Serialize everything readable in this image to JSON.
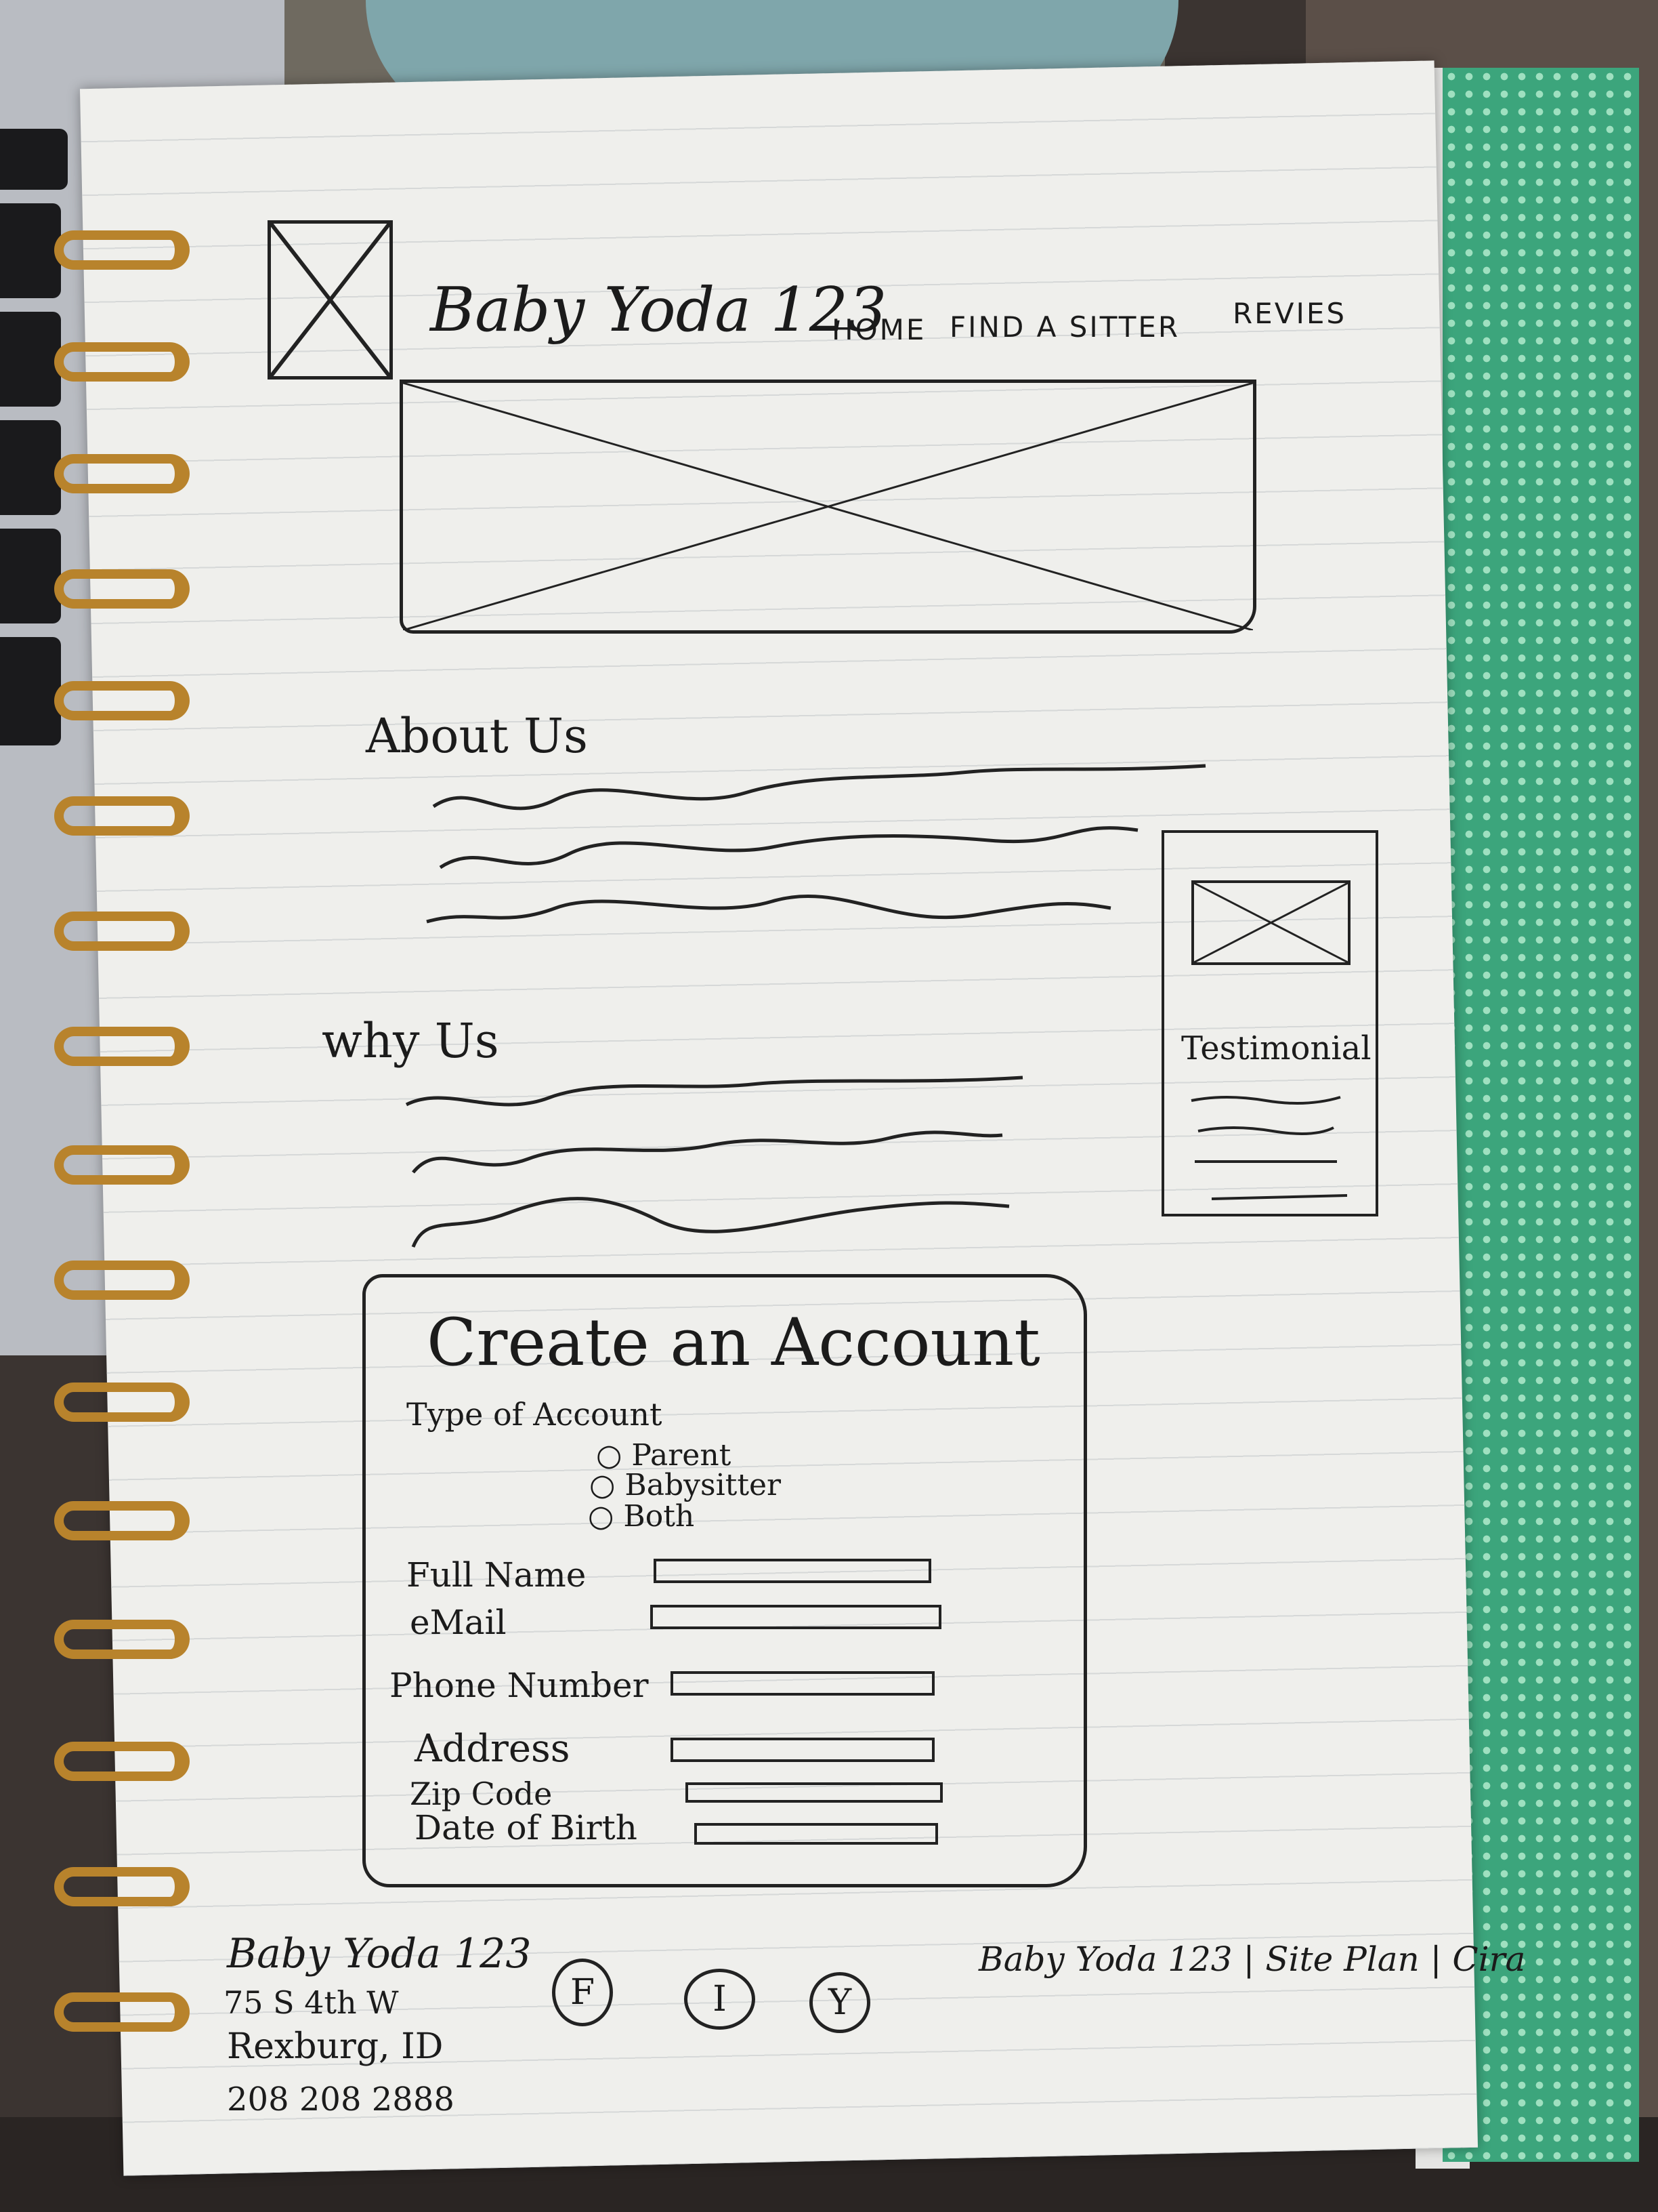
{
  "header": {
    "logo_icon": "image-placeholder-icon",
    "site_name": "Baby Yoda 123",
    "nav": [
      "HOME",
      "FIND A SITTER",
      "REVIES"
    ]
  },
  "hero": {
    "icon": "image-placeholder-icon"
  },
  "about": {
    "heading": "About Us"
  },
  "why": {
    "heading": "why Us"
  },
  "testimonial": {
    "label": "Testimonial",
    "icon": "image-placeholder-icon"
  },
  "form": {
    "title": "Create an Account",
    "type_label": "Type of Account",
    "options": [
      "Parent",
      "Babysitter",
      "Both"
    ],
    "fields": [
      "Full Name",
      "eMail",
      "Phone Number",
      "Address",
      "Zip Code",
      "Date of Birth"
    ]
  },
  "footer": {
    "name": "Baby Yoda 123",
    "street": "75 S 4th W",
    "city": "Rexburg, ID",
    "phone": "208 208 2888",
    "social": [
      "F",
      "I",
      "Y"
    ],
    "credit": "Baby Yoda 123 | Site Plan | Cira"
  }
}
